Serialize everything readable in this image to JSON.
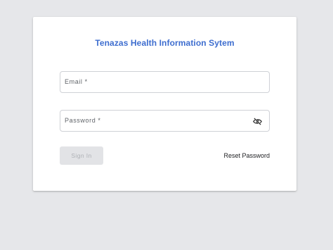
{
  "login": {
    "title": "Tenazas Health Information Sytem",
    "email_label": "Email *",
    "email_value": "",
    "password_label": "Password *",
    "password_value": "",
    "password_toggle_icon": "eye-off-icon",
    "signin_label": "Sign In",
    "reset_label": "Reset Password"
  },
  "colors": {
    "title": "#3d6dcf",
    "background": "#e6e7ea",
    "card": "#ffffff",
    "button_disabled_bg": "#e2e3e6",
    "button_disabled_text": "#aeb1b6"
  }
}
